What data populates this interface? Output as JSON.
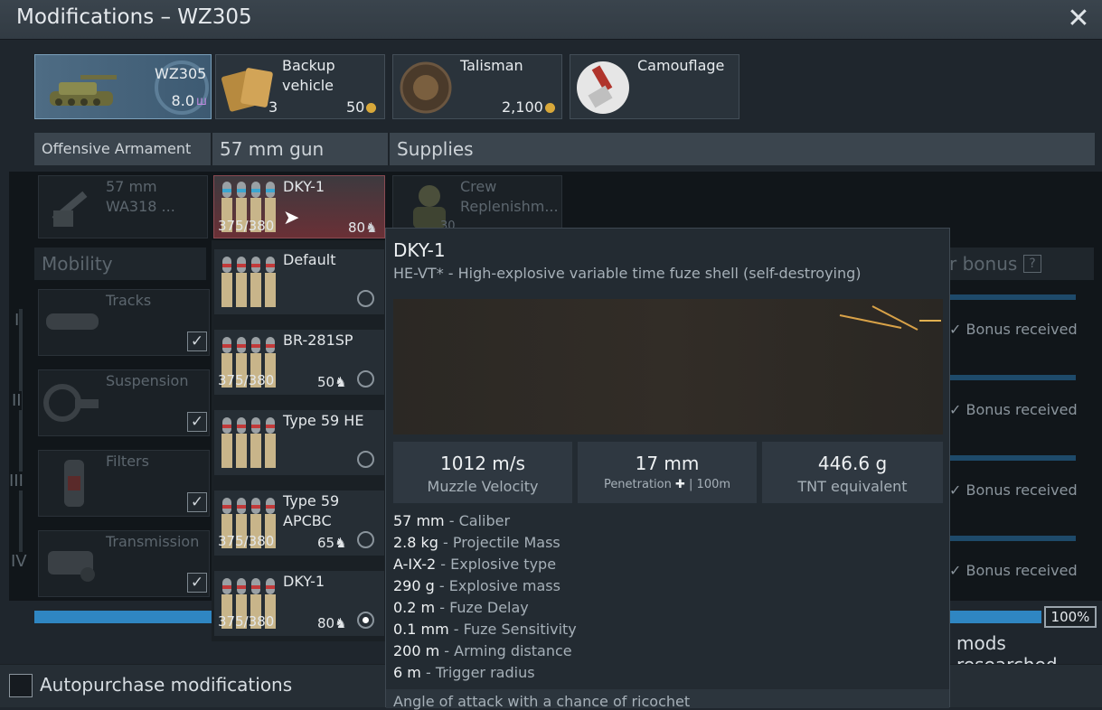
{
  "window": {
    "title": "Modifications – WZ305",
    "close_icon": "close-icon"
  },
  "top_cards": {
    "vehicle": {
      "name": "WZ305",
      "br": "8.0"
    },
    "backup": {
      "line1": "Backup",
      "line2": "vehicle",
      "count": "3",
      "price": "50"
    },
    "talisman": {
      "label": "Talisman",
      "price": "2,100"
    },
    "camouflage": {
      "label": "Camouflage"
    }
  },
  "headers": {
    "offensive": "Offensive Armament",
    "gun": "57 mm gun",
    "supplies": "Supplies",
    "mobility": "Mobility",
    "bonus": "r bonus",
    "bonus_help": "?"
  },
  "gun_slot": {
    "line1": "57 mm",
    "line2": "WA318 ..."
  },
  "crew_slot": {
    "line1": "Crew",
    "line2": "Replenishm...",
    "count": "30"
  },
  "selected_ammo": {
    "label": "DKY-1",
    "count": "375/380",
    "price": "80"
  },
  "ammo_list": [
    {
      "label": "Default",
      "count": "",
      "price": "",
      "selected": false
    },
    {
      "label": "BR-281SP",
      "count": "375/380",
      "price": "50",
      "selected": false
    },
    {
      "label": "Type 59 HE",
      "count": "",
      "price": "",
      "selected": false
    },
    {
      "label": "Type 59 APCBC",
      "count": "375/380",
      "price": "65",
      "selected": false
    },
    {
      "label": "DKY-1",
      "count": "375/380",
      "price": "80",
      "selected": true
    }
  ],
  "mobility": {
    "tiers": [
      "I",
      "II",
      "III",
      "IV"
    ],
    "items": [
      {
        "label": "Tracks"
      },
      {
        "label": "Suspension"
      },
      {
        "label": "Filters"
      },
      {
        "label": "Transmission"
      }
    ],
    "bonus_text": "Bonus received"
  },
  "tooltip": {
    "title": "DKY-1",
    "subtitle": "HE-VT* - High-explosive variable time fuze shell (self-destroying)",
    "stats": [
      {
        "value": "1012 m/s",
        "label": "Muzzle Velocity"
      },
      {
        "value": "17 mm",
        "label": "Penetration",
        "suffix": "| 100m"
      },
      {
        "value": "446.6 g",
        "label": "TNT equivalent"
      }
    ],
    "props": [
      {
        "value": "57 mm",
        "desc": "Caliber"
      },
      {
        "value": "2.8 kg",
        "desc": "Projectile Mass"
      },
      {
        "value": "A-IX-2",
        "desc": "Explosive type"
      },
      {
        "value": "290 g",
        "desc": "Explosive mass"
      },
      {
        "value": "0.2 m",
        "desc": "Fuze Delay"
      },
      {
        "value": "0.1 mm",
        "desc": "Fuze Sensitivity"
      },
      {
        "value": "200 m",
        "desc": "Arming distance"
      },
      {
        "value": "6 m",
        "desc": "Trigger radius"
      }
    ],
    "footer": "Angle of attack with a chance of ricochet"
  },
  "progress": {
    "percent_label": "100%",
    "fraction": 1.0,
    "mods_text": "mods researched"
  },
  "autopurchase": {
    "label": "Autopurchase modifications"
  }
}
